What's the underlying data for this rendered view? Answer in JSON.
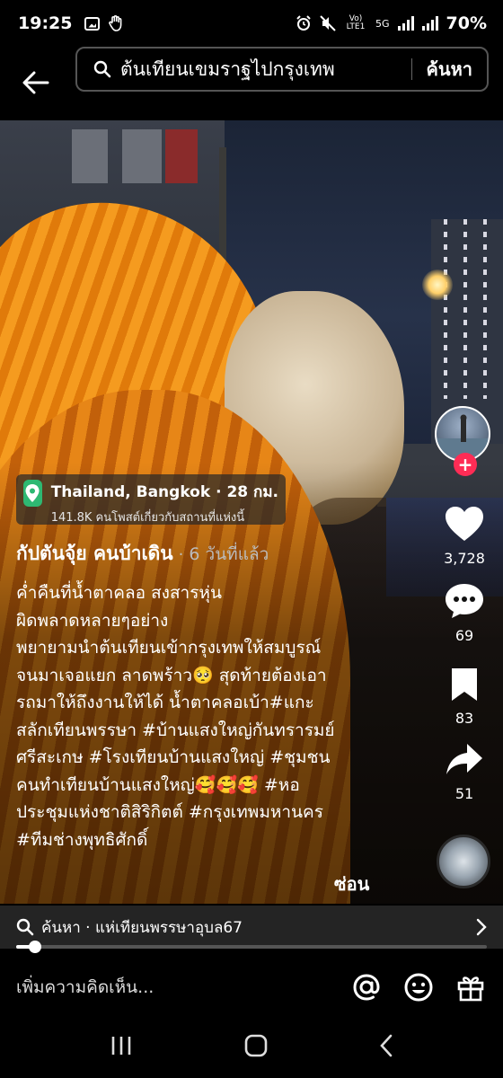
{
  "status_bar": {
    "time": "19:25",
    "battery": "70%",
    "network_label": "Vo) LTE1",
    "network_5g": "5G"
  },
  "search": {
    "query": "ต้นเทียนเขมราฐไปกรุงเทพ",
    "button_label": "ค้นหา"
  },
  "location": {
    "title": "Thailand, Bangkok · 28 กม.",
    "subtitle": "141.8K คนโพสต์เกี่ยวกับสถานที่แห่งนี้"
  },
  "post": {
    "author": "กัปตันจุ้ย คนบ้าเดิน",
    "time_ago": "6 วันที่แล้ว",
    "caption": "ค่ำคืนที่น้ำตาคลอ  สงสารหุ่น\nผิดพลาดหลายๆอย่าง\nพยายามนำต้นเทียนเข้ากรุงเทพให้สมบูรณ์\nจนมาเจอแยก ลาดพร้าว🥺 สุดท้ายต้องเอา\nรถมาให้ถึงงานให้ได้   น้ำตาคลอเบ้า#แกะ\nสลักเทียนพรรษา #บ้านแสงใหญ่กันทรารมย์\nศรีสะเกษ #โรงเทียนบ้านแสงใหญ่ #ชุมชน\nคนทำเทียนบ้านแสงใหญ่🥰🥰🥰 #หอ\nประชุมแห่งชาติสิริกิตต์ #กรุงเทพมหานคร\n#ทีมช่างพุทธิศักดิ์",
    "hide_label": "ซ่อน"
  },
  "actions": {
    "likes": "3,728",
    "comments": "69",
    "saves": "83",
    "shares": "51"
  },
  "related_search": {
    "label": "ค้นหา · แห่เทียนพรรษาอุบล67"
  },
  "playback": {
    "progress_fraction": 0.04
  },
  "comment_input": {
    "placeholder": "เพิ่มความคิดเห็น..."
  },
  "colors": {
    "accent": "#fe2c55",
    "location_green": "#2eb872"
  }
}
